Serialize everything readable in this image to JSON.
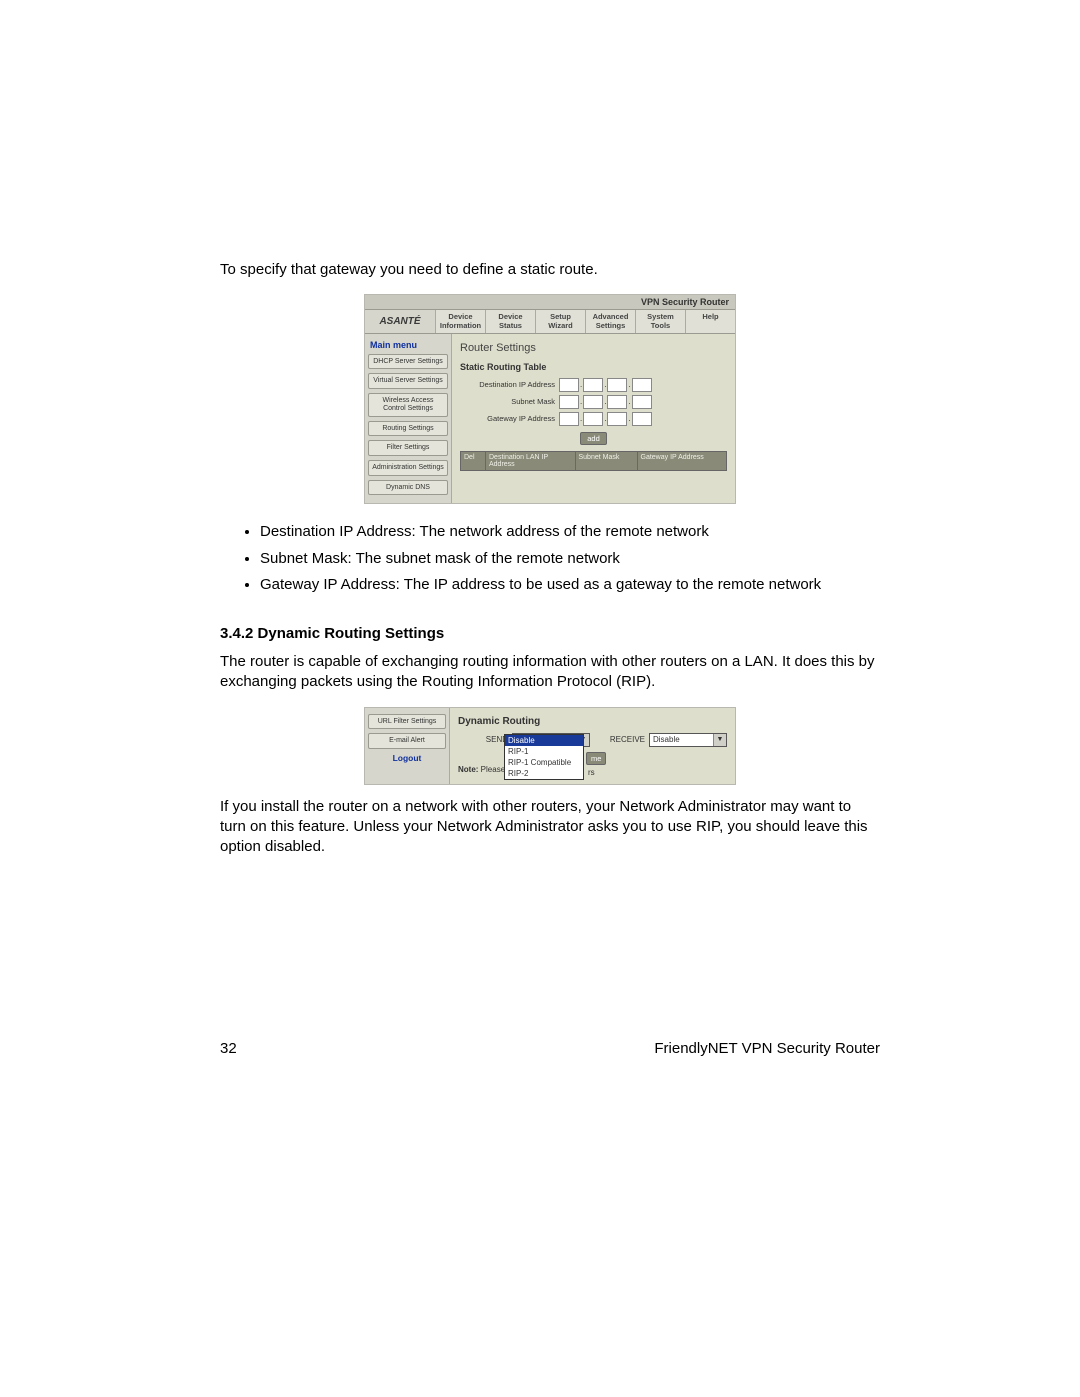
{
  "intro": "To specify that gateway you need to define a static route.",
  "shot1": {
    "titlebar": "VPN Security Router",
    "logo": "ASANTÉ",
    "tabs": [
      "Device Information",
      "Device Status",
      "Setup Wizard",
      "Advanced Settings",
      "System Tools",
      "Help"
    ],
    "mainmenu": "Main menu",
    "sidebar": [
      "DHCP Server Settings",
      "Virtual Server Settings",
      "Wireless Access Control Settings",
      "Routing Settings",
      "Filter Settings",
      "Administration Settings",
      "Dynamic DNS"
    ],
    "heading": "Router Settings",
    "subheading": "Static Routing Table",
    "labels": {
      "dest": "Destination IP Address",
      "mask": "Subnet Mask",
      "gw": "Gateway IP Address"
    },
    "add": "add",
    "tbl": {
      "del": "Del",
      "a": "Destination LAN IP Address",
      "b": "Subnet Mask",
      "c": "Gateway IP Address"
    }
  },
  "bullets": [
    "Destination IP Address: The network address of the remote network",
    "Subnet Mask: The subnet mask of the remote network",
    "Gateway IP Address: The IP address to be used as a gateway to the remote network"
  ],
  "section": "3.4.2 Dynamic Routing Settings",
  "para2": "The router is capable of exchanging routing information with other routers on a LAN. It does this by exchanging packets using the Routing Information Protocol (RIP).",
  "shot2": {
    "sidebar": [
      "URL Filter Settings",
      "E-mail Alert"
    ],
    "logout": "Logout",
    "heading": "Dynamic Routing",
    "send_label": "SEND",
    "receive_label": "RECEIVE",
    "send_value": "Disable",
    "receive_value": "Disable",
    "options": [
      "Disable",
      "RIP-1",
      "RIP-1 Compatible",
      "RIP-2"
    ],
    "note_prefix": "Note:",
    "note_text": " Please cli",
    "me_fragment": "me",
    "rs_fragment": "rs"
  },
  "para3": "If you install the router on a network with other routers, your Network Administrator may want to turn on this feature. Unless your Network Administrator asks you to use RIP, you should leave this option disabled.",
  "footer": {
    "page": "32",
    "product": "FriendlyNET VPN Security Router"
  }
}
